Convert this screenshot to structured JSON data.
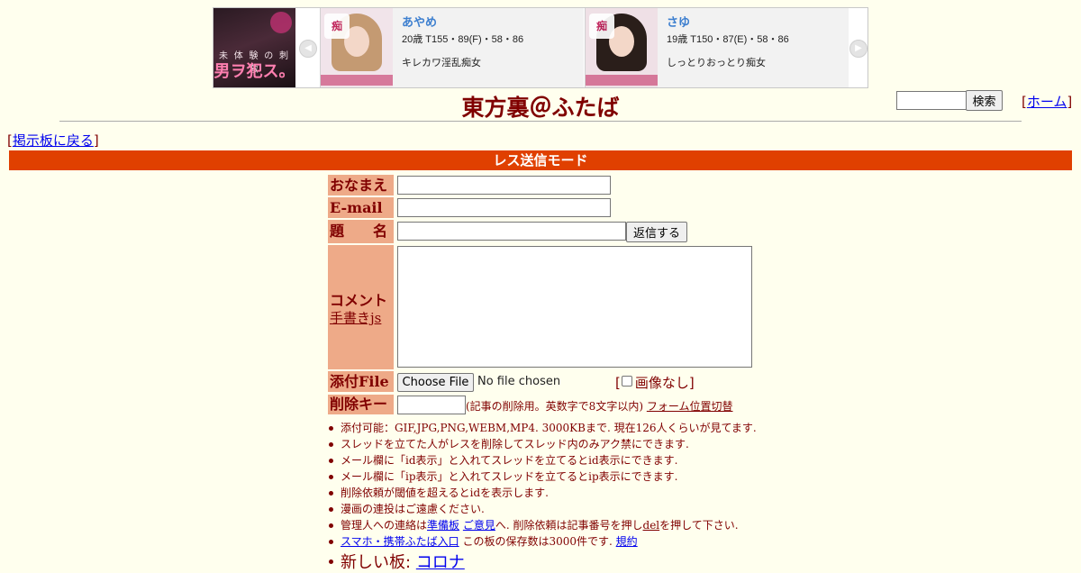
{
  "ad": {
    "left_image_text_small": "未 体 験 の 刺 激",
    "left_image_text_large": "男ヲ犯ス。",
    "prev_arrow": "◀",
    "next_arrow": "▶",
    "cards": [
      {
        "name": "あやめ",
        "stats": "20歳 T155・89(F)・58・86",
        "desc": "キレカワ淫乱痴女",
        "hair_color": "#c49a72"
      },
      {
        "name": "さゆ",
        "stats": "19歳 T150・87(E)・58・86",
        "desc": "しっとりおっとり痴女",
        "hair_color": "#2a1e1a"
      }
    ]
  },
  "header": {
    "title": "東方裏＠ふたば",
    "search_button": "検索",
    "home_link": "ホーム"
  },
  "nav": {
    "back_link": "掲示板に戻る"
  },
  "mode_bar": "レス送信モード",
  "form": {
    "name_label": "おなまえ",
    "email_label": "E-mail",
    "subject_label": "題　　名",
    "reply_button": "返信する",
    "comment_label": "コメント",
    "tegaki_link": "手書きjs",
    "file_label": "添付File",
    "choose_file": "Choose File",
    "file_status": "No file chosen",
    "no_image": "画像なし",
    "delkey_label": "削除キー",
    "delkey_note": "(記事の削除用。英数字で8文字以内)",
    "form_toggle_link": "フォーム位置切替"
  },
  "rules": {
    "r1": "添付可能：GIF,JPG,PNG,WEBM,MP4. 3000KBまで. 現在126人くらいが見てます.",
    "r2": "スレッドを立てた人がレスを削除してスレッド内のみアク禁にできます.",
    "r3": "メール欄に「id表示」と入れてスレッドを立てるとid表示にできます.",
    "r4": "メール欄に「ip表示」と入れてスレッドを立てるとip表示にできます.",
    "r5": "削除依頼が閾値を超えるとidを表示します.",
    "r6": "漫画の連投はご遠慮ください.",
    "r7_pre": "管理人への連絡は",
    "r7_link1": "準備板",
    "r7_link2": "ご意見",
    "r7_mid": "へ. 削除依頼は記事番号を押し",
    "r7_link3": "del",
    "r7_post": "を押して下さい.",
    "r8_link1": "スマホ・携帯ふたば入口",
    "r8_mid": "この板の保存数は3000件です.",
    "r8_link2": "規約"
  },
  "new_board": {
    "label": "新しい板:",
    "link": "コロナ"
  },
  "colors": {
    "background": "#ffffee",
    "text": "#800000",
    "mode_bar": "#e04000",
    "label_bg": "#eeaa88"
  }
}
